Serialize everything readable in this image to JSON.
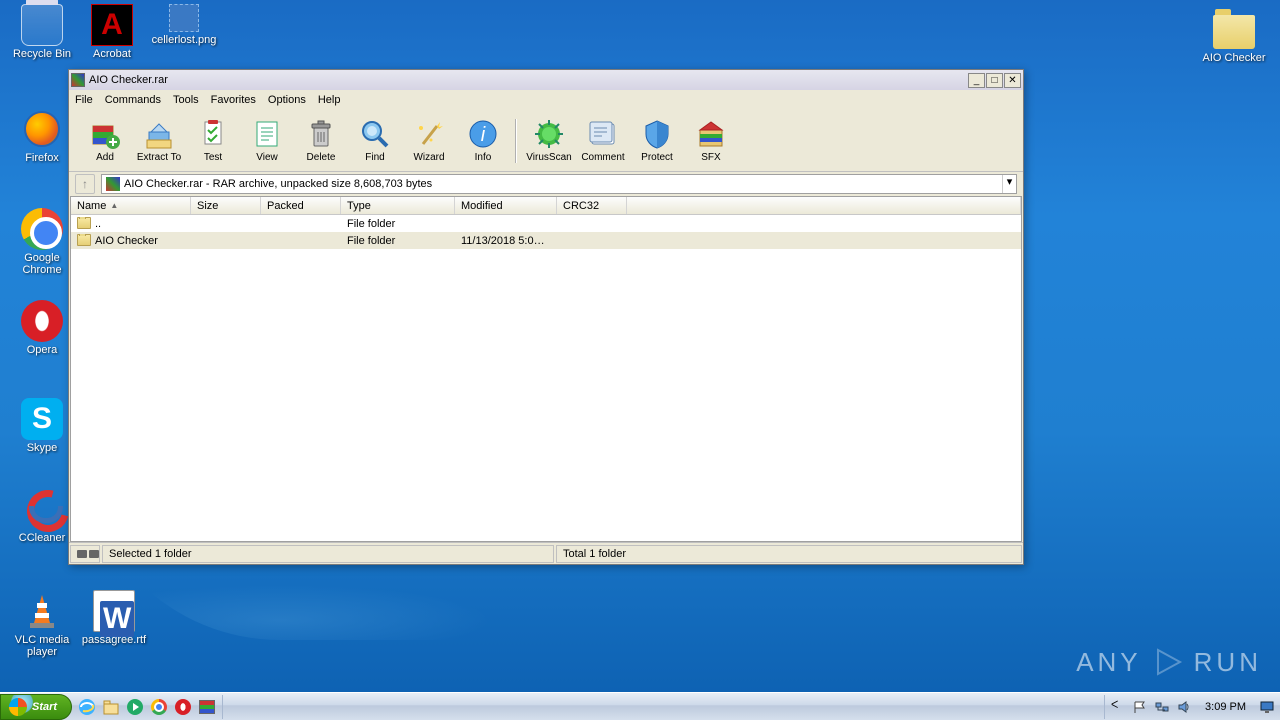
{
  "desktop_icons": {
    "recycle": "Recycle Bin",
    "acrobat": "Acrobat",
    "cellerlost": "cellerlost.png",
    "firefox": "Firefox",
    "chrome": "Google Chrome",
    "opera": "Opera",
    "skype": "Skype",
    "ccleaner": "CCleaner",
    "vlc": "VLC media player",
    "passagree": "passagree.rtf",
    "aio_folder": "AIO Checker"
  },
  "window": {
    "title": "AIO Checker.rar",
    "menu": {
      "file": "File",
      "commands": "Commands",
      "tools": "Tools",
      "favorites": "Favorites",
      "options": "Options",
      "help": "Help"
    },
    "toolbar": {
      "add": "Add",
      "extract": "Extract To",
      "test": "Test",
      "view": "View",
      "delete": "Delete",
      "find": "Find",
      "wizard": "Wizard",
      "info": "Info",
      "virus": "VirusScan",
      "comment": "Comment",
      "protect": "Protect",
      "sfx": "SFX"
    },
    "address": "AIO Checker.rar - RAR archive, unpacked size 8,608,703 bytes",
    "columns": {
      "name": "Name",
      "size": "Size",
      "packed": "Packed",
      "type": "Type",
      "modified": "Modified",
      "crc": "CRC32"
    },
    "rows": [
      {
        "name": "..",
        "type": "File folder",
        "modified": "",
        "crc": ""
      },
      {
        "name": "AIO Checker",
        "type": "File folder",
        "modified": "11/13/2018 5:0…",
        "crc": ""
      }
    ],
    "status": {
      "selected": "Selected 1 folder",
      "total": "Total 1 folder"
    }
  },
  "taskbar": {
    "start": "Start",
    "clock": "3:09 PM"
  },
  "watermark": "ANY RUN"
}
